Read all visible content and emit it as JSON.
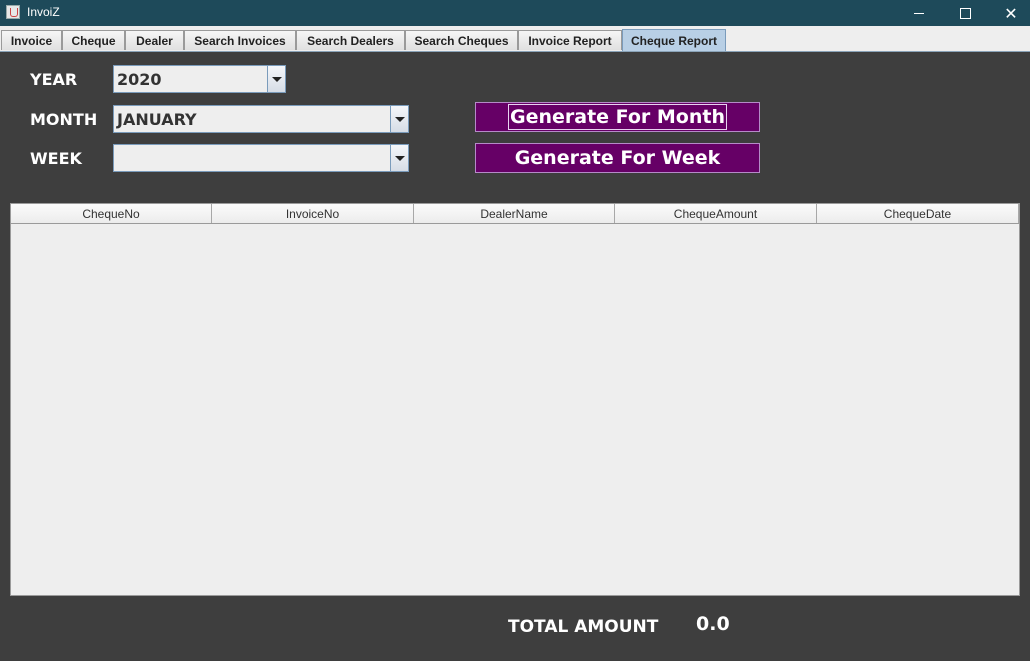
{
  "window": {
    "title": "InvoiZ",
    "icons": {
      "app": "java-app-icon",
      "minimize": "minimize-icon",
      "maximize": "maximize-icon",
      "close": "close-icon"
    }
  },
  "tabs": [
    {
      "label": "Invoice"
    },
    {
      "label": "Cheque"
    },
    {
      "label": "Dealer"
    },
    {
      "label": "Search Invoices"
    },
    {
      "label": "Search Dealers"
    },
    {
      "label": "Search Cheques"
    },
    {
      "label": "Invoice Report"
    },
    {
      "label": "Cheque Report",
      "active": true
    }
  ],
  "form": {
    "year_label": "YEAR",
    "year_value": "2020",
    "month_label": "MONTH",
    "month_value": "JANUARY",
    "week_label": "WEEK",
    "week_value": "",
    "generate_month_label": "Generate For Month",
    "generate_week_label": "Generate For Week"
  },
  "table": {
    "columns": [
      "ChequeNo",
      "InvoiceNo",
      "DealerName",
      "ChequeAmount",
      "ChequeDate"
    ],
    "rows": []
  },
  "summary": {
    "total_label": "TOTAL AMOUNT",
    "total_value": "0.0"
  },
  "colors": {
    "titlebar": "#1e4a5a",
    "background": "#3e3e3e",
    "button": "#660066",
    "active_tab": "#b8cfe5"
  }
}
